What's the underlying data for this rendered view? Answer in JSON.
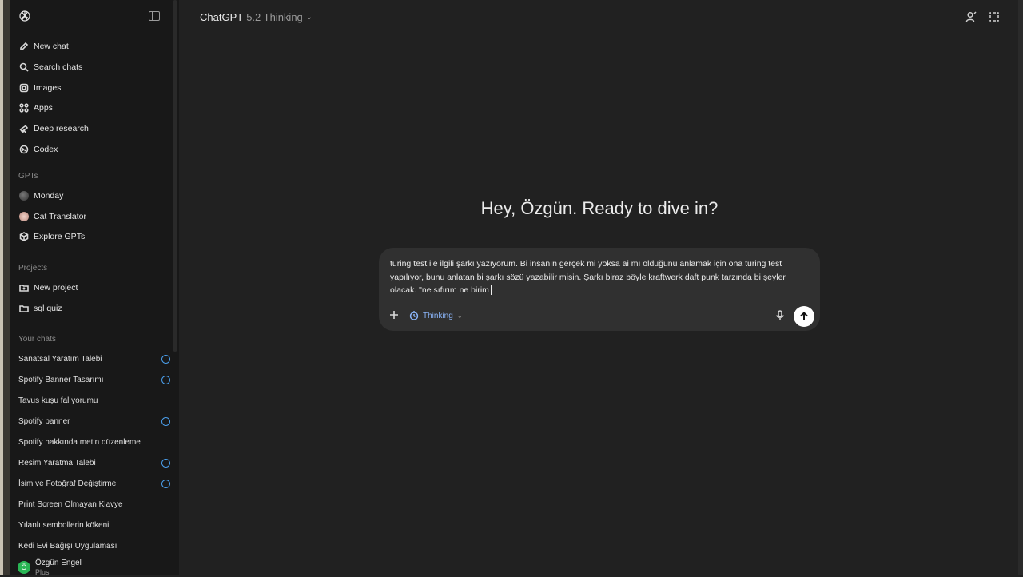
{
  "header": {
    "product": "ChatGPT",
    "model": "5.2 Thinking"
  },
  "sidebar": {
    "primary_items": [
      {
        "label": "New chat",
        "icon": "edit-icon"
      },
      {
        "label": "Search chats",
        "icon": "search-icon"
      },
      {
        "label": "Images",
        "icon": "image-icon"
      },
      {
        "label": "Apps",
        "icon": "apps-icon"
      },
      {
        "label": "Deep research",
        "icon": "telescope-icon"
      },
      {
        "label": "Codex",
        "icon": "codex-icon"
      }
    ],
    "gpts_label": "GPTs",
    "gpts": [
      {
        "label": "Monday"
      },
      {
        "label": "Cat Translator"
      },
      {
        "label": "Explore GPTs"
      }
    ],
    "projects_label": "Projects",
    "projects": [
      {
        "label": "New project"
      },
      {
        "label": "sql quiz"
      }
    ],
    "your_chats_label": "Your chats",
    "chats": [
      {
        "label": "Sanatsal Yaratım Talebi",
        "indicator": true
      },
      {
        "label": "Spotify Banner Tasarımı",
        "indicator": true
      },
      {
        "label": "Tavus kuşu fal yorumu",
        "indicator": false
      },
      {
        "label": "Spotify banner",
        "indicator": true
      },
      {
        "label": "Spotify hakkında metin düzenleme",
        "indicator": false
      },
      {
        "label": "Resim Yaratma Talebi",
        "indicator": true
      },
      {
        "label": "İsim ve Fotoğraf Değiştirme",
        "indicator": true
      },
      {
        "label": "Print Screen Olmayan Klavye",
        "indicator": false
      },
      {
        "label": "Yılanlı sembollerin kökeni",
        "indicator": false
      },
      {
        "label": "Kedi Evi Bağışı Uygulaması",
        "indicator": false
      }
    ],
    "user": {
      "initial": "Ö",
      "name": "Özgün Engel",
      "plan": "Plus"
    }
  },
  "main": {
    "greeting": "Hey, Özgün. Ready to dive in?",
    "composer": {
      "text": "turing test ile ilgili şarkı yazıyorum. Bi insanın gerçek mi yoksa ai mı olduğunu anlamak için ona turing test yapılıyor, bunu anlatan bi şarkı sözü yazabilir misin. Şarkı biraz böyle kraftwerk daft punk tarzında bi şeyler olacak. \"ne sıfırım ne birim",
      "mode_label": "Thinking"
    }
  },
  "colors": {
    "background": "#212121",
    "sidebar": "#181818",
    "composer": "#303030",
    "accent": "#4a9eea",
    "avatar": "#29b554"
  }
}
